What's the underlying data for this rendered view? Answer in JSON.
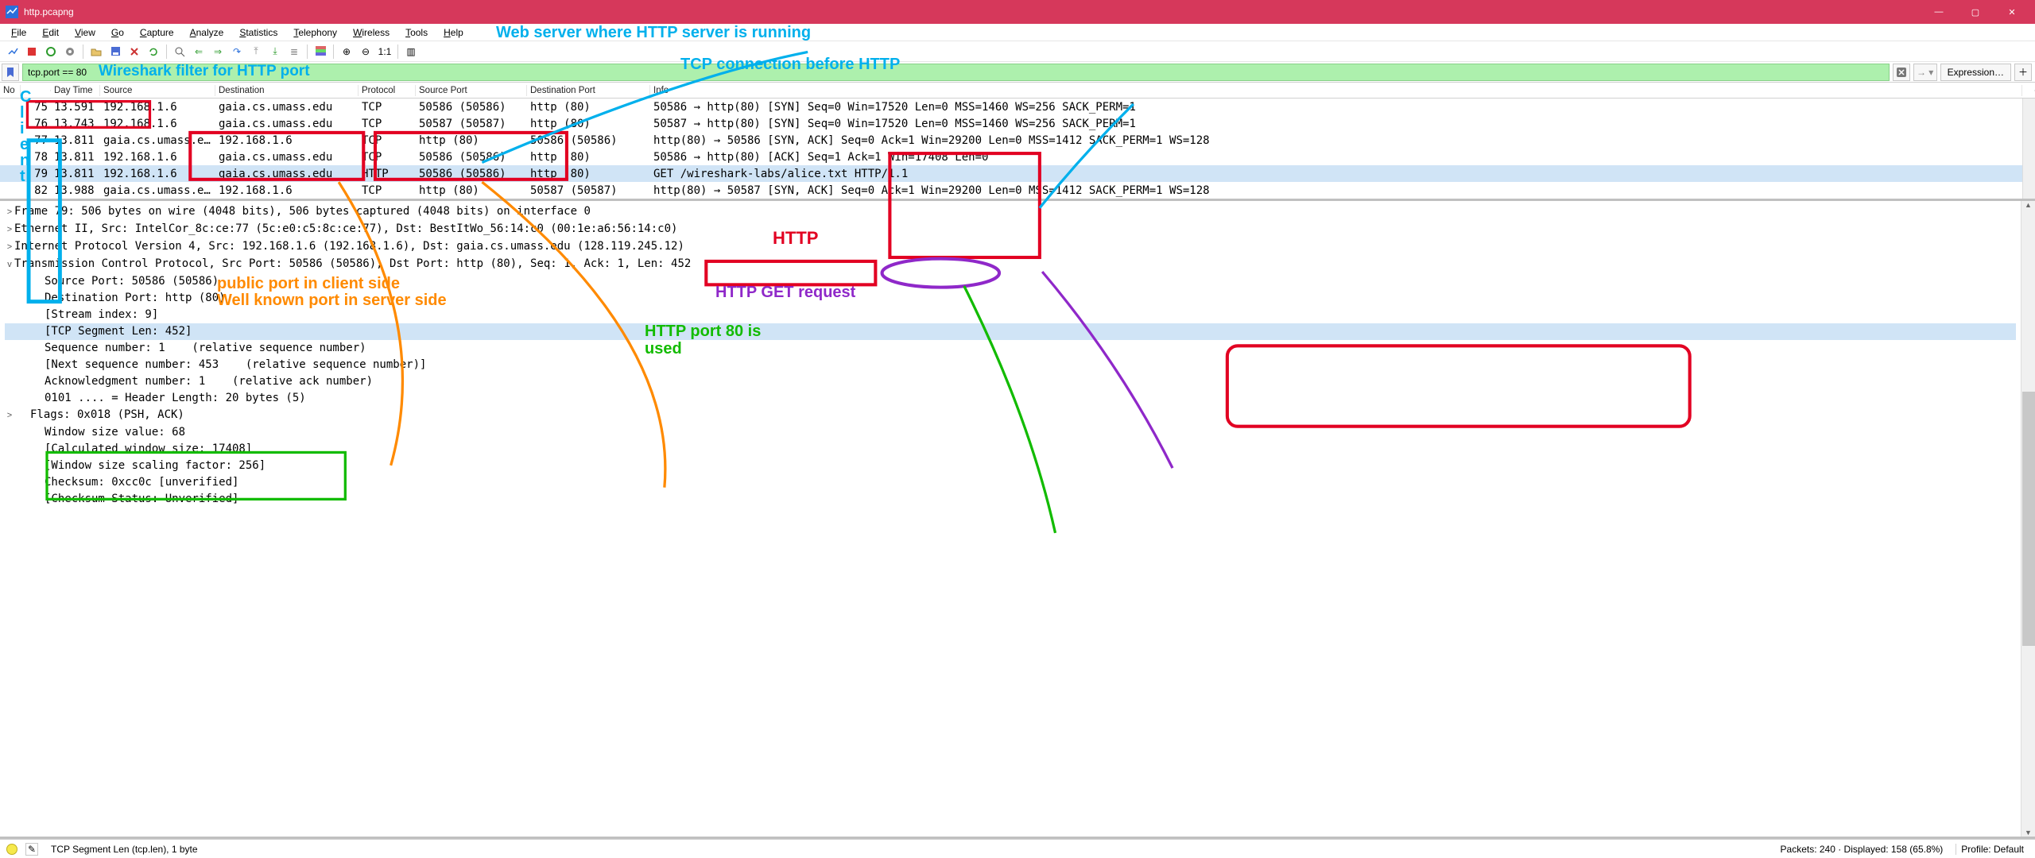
{
  "window": {
    "title": "http.pcapng",
    "win_min": "—",
    "win_max": "▢",
    "win_close": "✕"
  },
  "menu": [
    "File",
    "Edit",
    "View",
    "Go",
    "Capture",
    "Analyze",
    "Statistics",
    "Telephony",
    "Wireless",
    "Tools",
    "Help"
  ],
  "filter": {
    "value": "tcp.port == 80",
    "expression": "Expression…"
  },
  "packet_table": {
    "columns": [
      "No",
      "",
      "Day Time",
      "Source",
      "Destination",
      "Protocol",
      "Source Port",
      "Destination Port",
      "Info"
    ],
    "rows": [
      {
        "no": "75",
        "time": "13.591",
        "src": "192.168.1.6",
        "dst": "gaia.cs.umass.edu",
        "proto": "TCP",
        "sport": "50586 (50586)",
        "dport": "http (80)",
        "info": "50586 → http(80) [SYN] Seq=0 Win=17520 Len=0 MSS=1460 WS=256 SACK_PERM=1"
      },
      {
        "no": "76",
        "time": "13.743",
        "src": "192.168.1.6",
        "dst": "gaia.cs.umass.edu",
        "proto": "TCP",
        "sport": "50587 (50587)",
        "dport": "http (80)",
        "info": "50587 → http(80) [SYN] Seq=0 Win=17520 Len=0 MSS=1460 WS=256 SACK_PERM=1"
      },
      {
        "no": "77",
        "time": "13.811",
        "src": "gaia.cs.umass.e…",
        "dst": "192.168.1.6",
        "proto": "TCP",
        "sport": "http (80)",
        "dport": "50586 (50586)",
        "info": "http(80) → 50586 [SYN, ACK] Seq=0 Ack=1 Win=29200 Len=0 MSS=1412 SACK_PERM=1 WS=128"
      },
      {
        "no": "78",
        "time": "13.811",
        "src": "192.168.1.6",
        "dst": "gaia.cs.umass.edu",
        "proto": "TCP",
        "sport": "50586 (50586)",
        "dport": "http (80)",
        "info": "50586 → http(80) [ACK] Seq=1 Ack=1 Win=17408 Len=0"
      },
      {
        "no": "79",
        "time": "13.811",
        "src": "192.168.1.6",
        "dst": "gaia.cs.umass.edu",
        "proto": "HTTP",
        "sport": "50586 (50586)",
        "dport": "http (80)",
        "info": "GET /wireshark-labs/alice.txt HTTP/1.1",
        "sel": true
      },
      {
        "no": "82",
        "time": "13.988",
        "src": "gaia.cs.umass.e…",
        "dst": "192.168.1.6",
        "proto": "TCP",
        "sport": "http (80)",
        "dport": "50587 (50587)",
        "info": "http(80) → 50587 [SYN, ACK] Seq=0 Ack=1 Win=29200 Len=0 MSS=1412 SACK_PERM=1 WS=128"
      }
    ]
  },
  "details": {
    "lines": [
      {
        "tw": ">",
        "ind": 0,
        "text": "Frame 79: 506 bytes on wire (4048 bits), 506 bytes captured (4048 bits) on interface 0"
      },
      {
        "tw": ">",
        "ind": 0,
        "text": "Ethernet II, Src: IntelCor_8c:ce:77 (5c:e0:c5:8c:ce:77), Dst: BestItWo_56:14:c0 (00:1e:a6:56:14:c0)"
      },
      {
        "tw": ">",
        "ind": 0,
        "text": "Internet Protocol Version 4, Src: 192.168.1.6 (192.168.1.6), Dst: gaia.cs.umass.edu (128.119.245.12)"
      },
      {
        "tw": "v",
        "ind": 0,
        "text": "Transmission Control Protocol, Src Port: 50586 (50586), Dst Port: http (80), Seq: 1, Ack: 1, Len: 452"
      },
      {
        "tw": "",
        "ind": 2,
        "text": "Source Port: 50586 (50586)",
        "greenbox": true
      },
      {
        "tw": "",
        "ind": 2,
        "text": "Destination Port: http (80)",
        "greenbox": true
      },
      {
        "tw": "",
        "ind": 2,
        "text": "[Stream index: 9]"
      },
      {
        "tw": "",
        "ind": 2,
        "text": "[TCP Segment Len: 452]",
        "sel": true
      },
      {
        "tw": "",
        "ind": 2,
        "text": "Sequence number: 1    (relative sequence number)"
      },
      {
        "tw": "",
        "ind": 2,
        "text": "[Next sequence number: 453    (relative sequence number)]"
      },
      {
        "tw": "",
        "ind": 2,
        "text": "Acknowledgment number: 1    (relative ack number)"
      },
      {
        "tw": "",
        "ind": 2,
        "text": "0101 .... = Header Length: 20 bytes (5)"
      },
      {
        "tw": ">",
        "ind": 1,
        "text": "Flags: 0x018 (PSH, ACK)"
      },
      {
        "tw": "",
        "ind": 2,
        "text": "Window size value: 68"
      },
      {
        "tw": "",
        "ind": 2,
        "text": "[Calculated window size: 17408]"
      },
      {
        "tw": "",
        "ind": 2,
        "text": "[Window size scaling factor: 256]"
      },
      {
        "tw": "",
        "ind": 2,
        "text": "Checksum: 0xcc0c [unverified]"
      },
      {
        "tw": "",
        "ind": 2,
        "text": "[Checksum Status: Unverified]"
      }
    ]
  },
  "status": {
    "field": "TCP Segment Len (tcp.len), 1 byte",
    "packets": "Packets: 240 · Displayed: 158 (65.8%)",
    "profile": "Profile: Default"
  },
  "annotations": {
    "client": "C\nl\ni\ne\nn\nt",
    "filter_label": "Wireshark filter for HTTP port",
    "webserver": "Web server where HTTP server is running",
    "tcp_before": "TCP connection before HTTP",
    "http_box": "HTTP",
    "http_get": "HTTP GET request",
    "http80": "HTTP port 80 is\nused",
    "pubport": "public port in client side",
    "wellknown": "Well known port in server side"
  }
}
